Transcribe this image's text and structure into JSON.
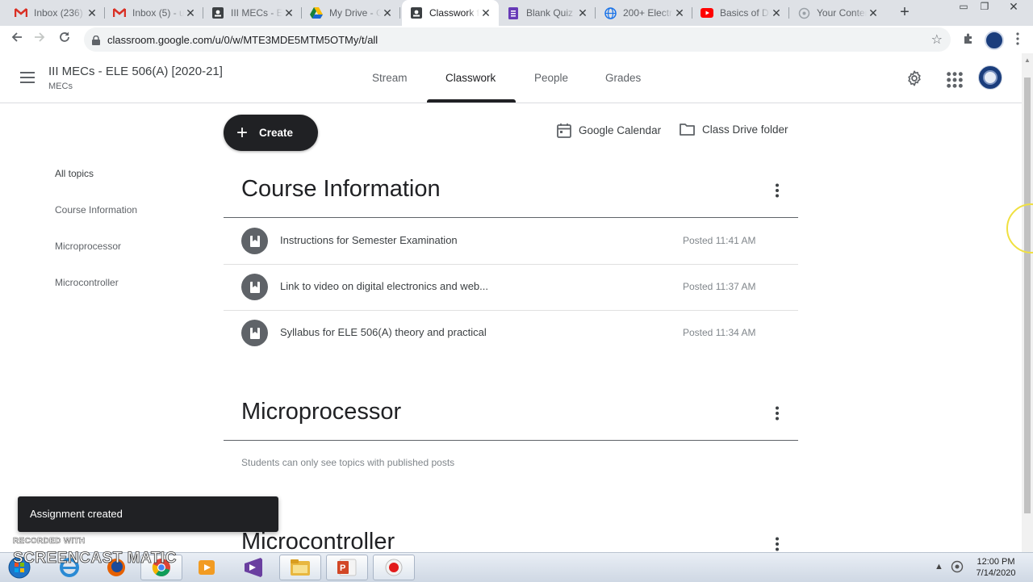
{
  "browser": {
    "tabs": [
      {
        "title": "Inbox (236)",
        "icon": "gmail-icon",
        "active": false
      },
      {
        "title": "Inbox (5) - u",
        "icon": "gmail-icon",
        "active": false
      },
      {
        "title": "III MECs - El",
        "icon": "classroom-icon",
        "active": false
      },
      {
        "title": "My Drive - G",
        "icon": "drive-icon",
        "active": false
      },
      {
        "title": "Classwork fo",
        "icon": "classroom-icon",
        "active": true
      },
      {
        "title": "Blank Quiz -",
        "icon": "forms-icon",
        "active": false
      },
      {
        "title": "200+ Electro",
        "icon": "globe-icon",
        "active": false
      },
      {
        "title": "Basics of Dig",
        "icon": "youtube-icon",
        "active": false
      },
      {
        "title": "Your Conten",
        "icon": "loading-icon",
        "active": false
      }
    ],
    "url": "classroom.google.com/u/0/w/MTE3MDE5MTM5OTMy/t/all"
  },
  "classroom": {
    "class_title": "III MECs - ELE 506(A) [2020-21]",
    "class_section": "MECs",
    "nav": {
      "stream": "Stream",
      "classwork": "Classwork",
      "people": "People",
      "grades": "Grades"
    },
    "active_nav": "Classwork"
  },
  "topics": [
    {
      "label": "All topics",
      "selected": true
    },
    {
      "label": "Course Information",
      "selected": false
    },
    {
      "label": "Microprocessor",
      "selected": false
    },
    {
      "label": "Microcontroller",
      "selected": false
    }
  ],
  "actions": {
    "create": "Create",
    "calendar": "Google Calendar",
    "drive": "Class Drive folder"
  },
  "sections": [
    {
      "title": "Course Information",
      "items": [
        {
          "title": "Instructions for Semester Examination",
          "posted": "Posted 11:41 AM"
        },
        {
          "title": "Link to video on digital electronics and web...",
          "posted": "Posted 11:37 AM"
        },
        {
          "title": "Syllabus for ELE 506(A) theory and practical",
          "posted": "Posted 11:34 AM"
        }
      ]
    },
    {
      "title": "Microprocessor",
      "note": "Students can only see topics with published posts"
    },
    {
      "title": "Microcontroller"
    }
  ],
  "snackbar": "Assignment created",
  "watermark": {
    "small": "RECORDED WITH",
    "big": "SCREENCAST  MATIC"
  },
  "taskbar": {
    "time": "12:00 PM",
    "date": "7/14/2020"
  },
  "colors": {
    "accent": "#202124",
    "tab_bg": "#dee1e6",
    "muted": "#5f6368"
  }
}
